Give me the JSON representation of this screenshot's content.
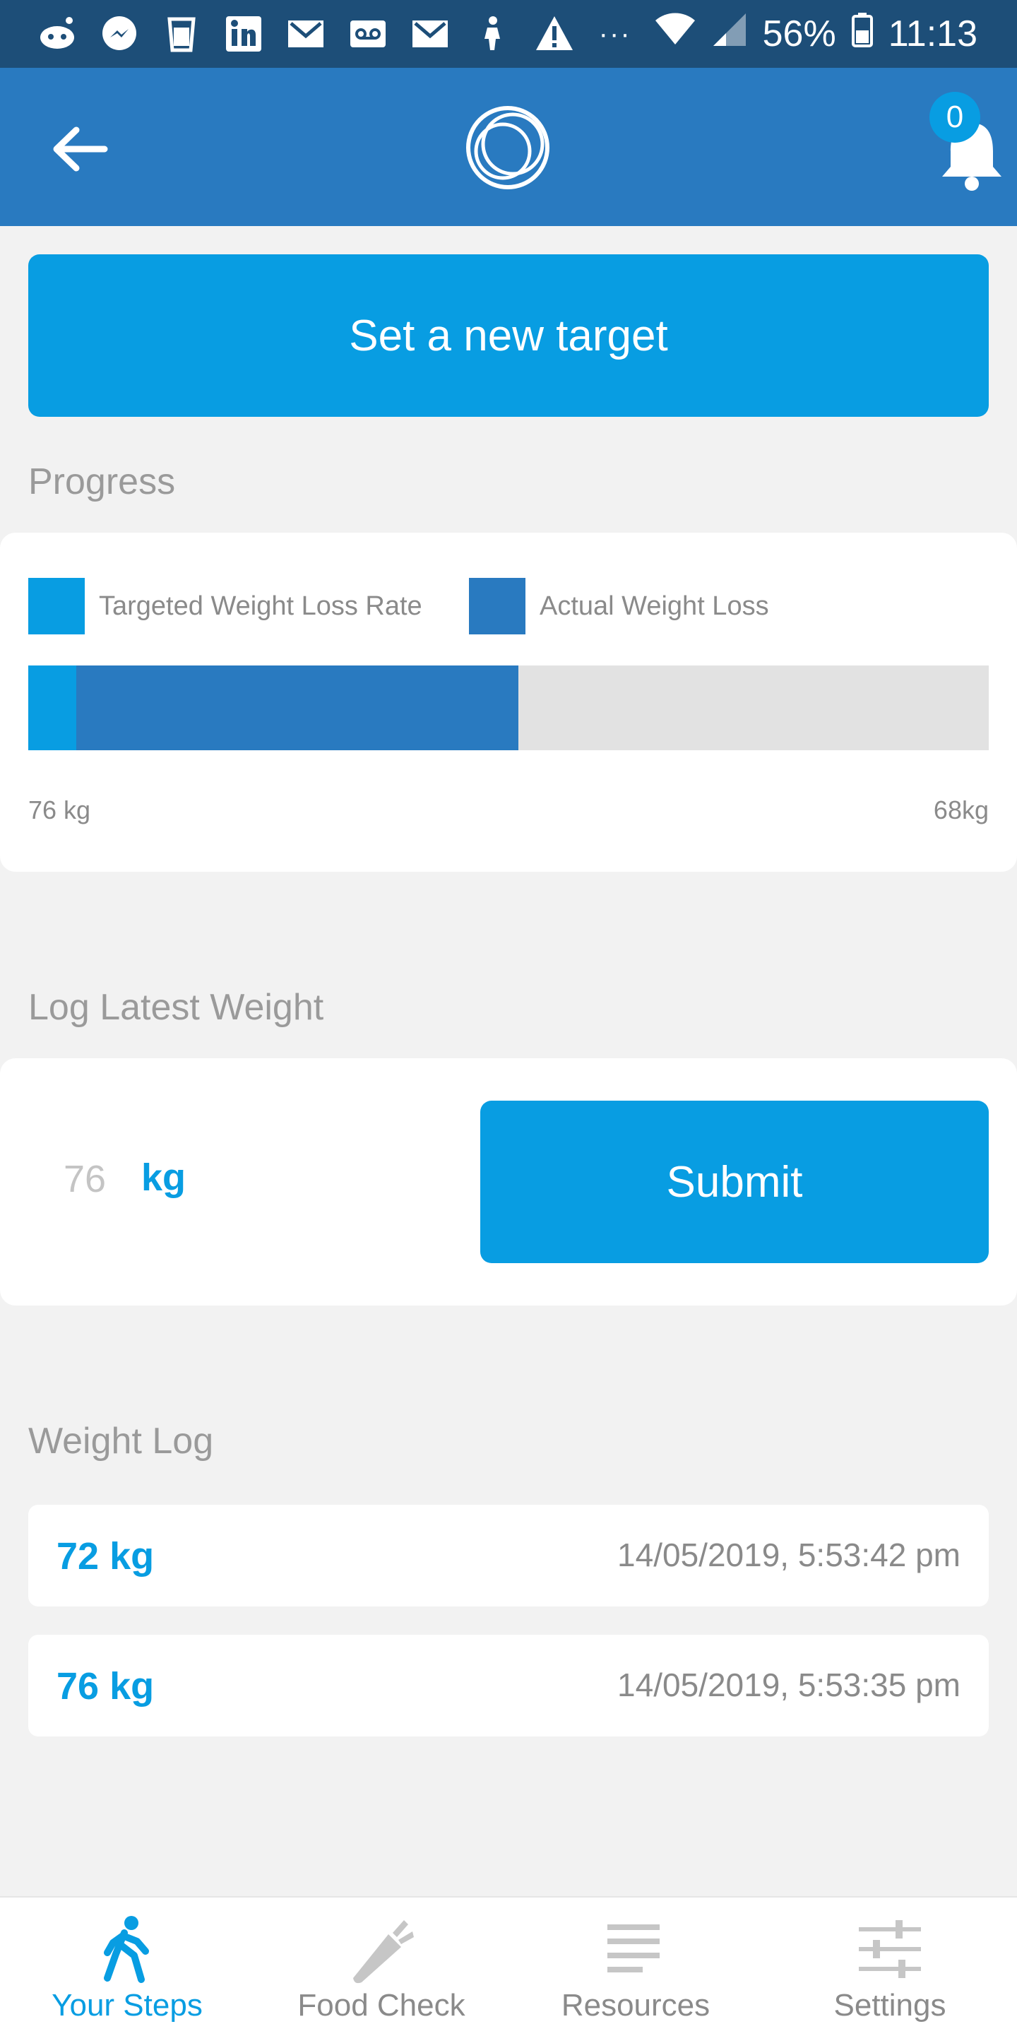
{
  "status_bar": {
    "battery": "56%",
    "time": "11:13",
    "overflow": "···",
    "left_icons": [
      "reddit-icon",
      "messenger-icon",
      "cup-icon",
      "linkedin-icon",
      "gmail-icon",
      "voicemail-icon",
      "gmail-icon",
      "person-icon",
      "warning-icon"
    ]
  },
  "header": {
    "notification_count": "0"
  },
  "target_button_label": "Set a new target",
  "progress": {
    "title": "Progress",
    "legend": [
      {
        "label": "Targeted Weight Loss Rate",
        "color": "#089de2"
      },
      {
        "label": "Actual Weight Loss",
        "color": "#297ac0"
      }
    ],
    "start_label": "76 kg",
    "end_label": "68kg",
    "targeted_fraction": 0.05,
    "actual_fraction": 0.51
  },
  "log_weight": {
    "title": "Log Latest Weight",
    "input_placeholder": "76",
    "unit": "kg",
    "submit_label": "Submit"
  },
  "weight_log": {
    "title": "Weight Log",
    "entries": [
      {
        "weight": "72 kg",
        "timestamp": "14/05/2019, 5:53:42 pm"
      },
      {
        "weight": "76 kg",
        "timestamp": "14/05/2019, 5:53:35 pm"
      }
    ]
  },
  "nav": {
    "items": [
      {
        "label": "Your Steps",
        "icon": "walking-icon",
        "active": true
      },
      {
        "label": "Food Check",
        "icon": "carrot-icon",
        "active": false
      },
      {
        "label": "Resources",
        "icon": "list-icon",
        "active": false
      },
      {
        "label": "Settings",
        "icon": "sliders-icon",
        "active": false
      }
    ]
  },
  "colors": {
    "status_bar": "#1d4e78",
    "app_bar": "#297ac0",
    "accent": "#089de2",
    "background": "#f2f2f2"
  }
}
